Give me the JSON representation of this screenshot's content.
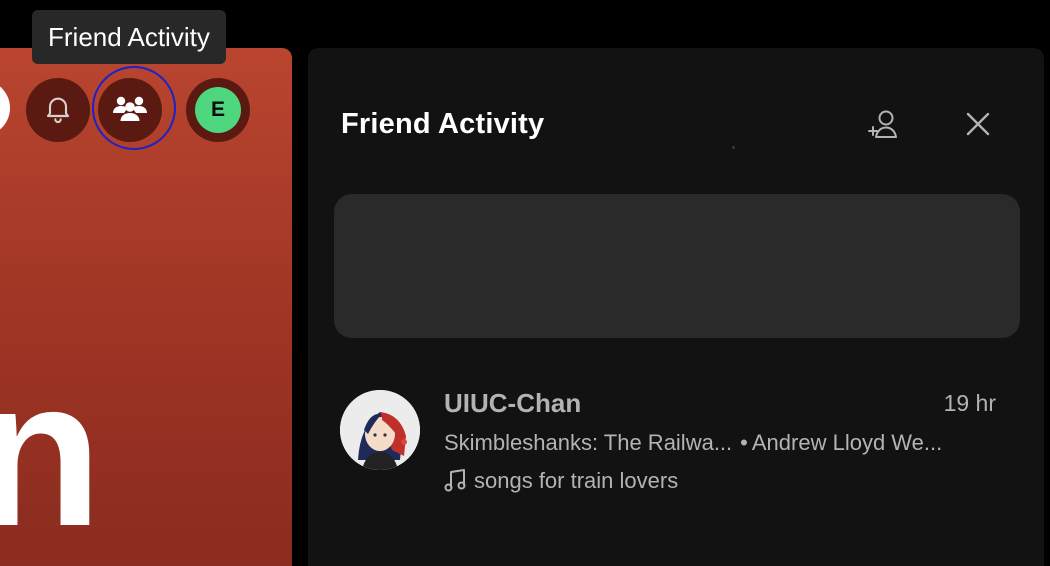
{
  "tooltip": {
    "text": "Friend Activity"
  },
  "hero": {
    "heading_fragment": "n"
  },
  "topbar": {
    "bell_icon": "bell-icon",
    "friends_icon": "friend-activity-icon",
    "avatar_initial": "E",
    "avatar_color": "#4fd77f"
  },
  "panel": {
    "title": "Friend Activity",
    "add_friend_icon": "add-friend-icon",
    "close_icon": "close-icon"
  },
  "friends": [
    {
      "name": "UIUC-Chan",
      "time": "19 hr",
      "song": "Skimbleshanks: The Railwa...",
      "separator": "•",
      "artist": "Andrew Lloyd We...",
      "playlist": "songs for train lovers",
      "playlist_icon": "music-note-icon"
    }
  ],
  "colors": {
    "hero_red": "#b9452f",
    "panel_bg": "#121212",
    "highlight_ring": "#1b22c8"
  }
}
